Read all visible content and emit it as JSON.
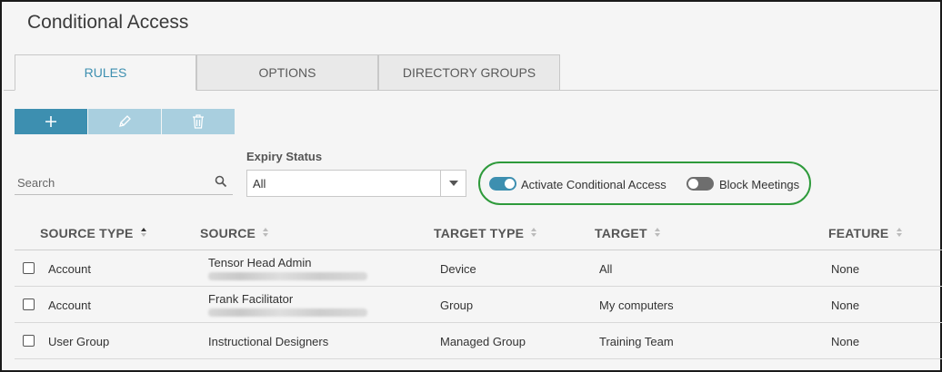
{
  "header": {
    "title": "Conditional Access"
  },
  "tabs": [
    {
      "label": "RULES",
      "active": true
    },
    {
      "label": "OPTIONS",
      "active": false
    },
    {
      "label": "DIRECTORY GROUPS",
      "active": false
    }
  ],
  "toolbar": {
    "add_icon": "plus-icon",
    "edit_icon": "pencil-icon",
    "delete_icon": "trash-icon"
  },
  "search": {
    "placeholder": "Search",
    "value": ""
  },
  "expiry": {
    "label": "Expiry Status",
    "value": "All"
  },
  "toggles": [
    {
      "label": "Activate Conditional Access",
      "on": true
    },
    {
      "label": "Block Meetings",
      "on": false
    }
  ],
  "table": {
    "columns": [
      "SOURCE TYPE",
      "SOURCE",
      "TARGET TYPE",
      "TARGET",
      "FEATURE"
    ],
    "rows": [
      {
        "source_type": "Account",
        "source": "Tensor Head Admin",
        "target_type": "Device",
        "target": "All",
        "feature": "None"
      },
      {
        "source_type": "Account",
        "source": "Frank Facilitator",
        "target_type": "Group",
        "target": "My computers",
        "feature": "None"
      },
      {
        "source_type": "User Group",
        "source": "Instructional Designers",
        "target_type": "Managed Group",
        "target": "Training Team",
        "feature": "None"
      }
    ]
  },
  "colors": {
    "accent": "#3d8fb0",
    "accent_light": "#a9cfdf",
    "highlight_border": "#2e9a3b",
    "toggle_off": "#6e6e6e"
  }
}
